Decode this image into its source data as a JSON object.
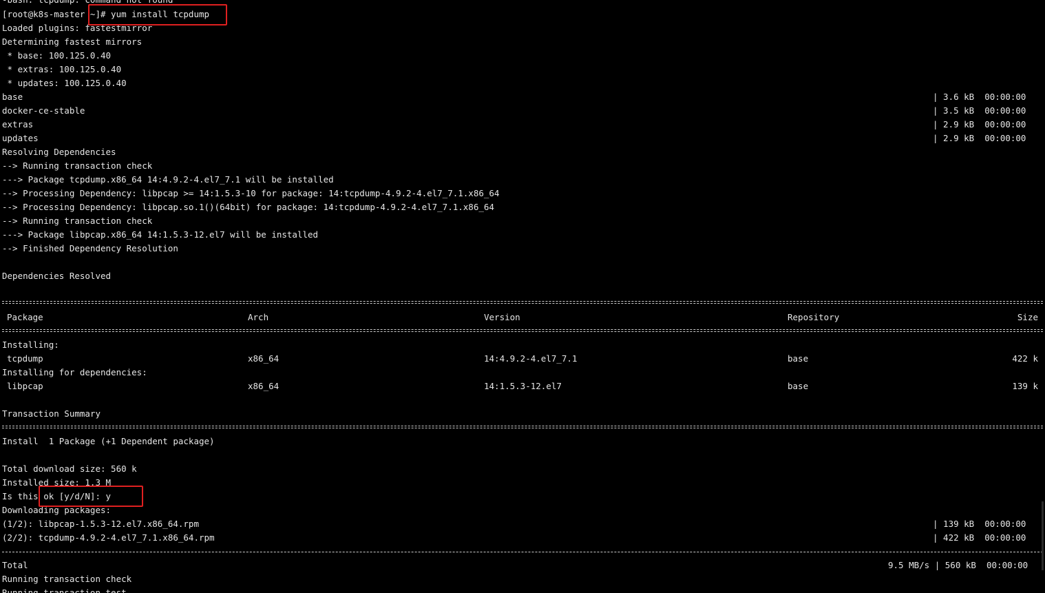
{
  "prev_output": "-bash: tcpdump: command not found",
  "prompt": "[root@k8s-master ~]",
  "command": "# yum install tcpdump",
  "plugins": "Loaded plugins: fastestmirror",
  "determining": "Determining fastest mirrors",
  "mirror_base": " * base: 100.125.0.40",
  "mirror_extras": " * extras: 100.125.0.40",
  "mirror_updates": " * updates: 100.125.0.40",
  "repos": [
    {
      "name": "base",
      "size": "| 3.6 kB  00:00:00"
    },
    {
      "name": "docker-ce-stable",
      "size": "| 3.5 kB  00:00:00"
    },
    {
      "name": "extras",
      "size": "| 2.9 kB  00:00:00"
    },
    {
      "name": "updates",
      "size": "| 2.9 kB  00:00:00"
    }
  ],
  "deps": [
    "Resolving Dependencies",
    "--> Running transaction check",
    "---> Package tcpdump.x86_64 14:4.9.2-4.el7_7.1 will be installed",
    "--> Processing Dependency: libpcap >= 14:1.5.3-10 for package: 14:tcpdump-4.9.2-4.el7_7.1.x86_64",
    "--> Processing Dependency: libpcap.so.1()(64bit) for package: 14:tcpdump-4.9.2-4.el7_7.1.x86_64",
    "--> Running transaction check",
    "---> Package libpcap.x86_64 14:1.5.3-12.el7 will be installed",
    "--> Finished Dependency Resolution"
  ],
  "deps_resolved": "Dependencies Resolved",
  "table": {
    "headers": {
      "package": "Package",
      "arch": "Arch",
      "version": "Version",
      "repository": "Repository",
      "size": "Size"
    },
    "installing_label": "Installing:",
    "installing": {
      "package": "tcpdump",
      "arch": "x86_64",
      "version": "14:4.9.2-4.el7_7.1",
      "repository": "base",
      "size": "422 k"
    },
    "deps_label": "Installing for dependencies:",
    "dependency": {
      "package": "libpcap",
      "arch": "x86_64",
      "version": "14:1.5.3-12.el7",
      "repository": "base",
      "size": "139 k"
    }
  },
  "summary_title": "Transaction Summary",
  "install_summary": "Install  1 Package (+1 Dependent package)",
  "total_download": "Total download size: 560 k",
  "installed_size": "Installed size: 1.3 M",
  "confirm_prompt": "Is this ok [y/d/N]: y",
  "downloading": "Downloading packages:",
  "downloads": [
    {
      "file": "(1/2): libpcap-1.5.3-12.el7.x86_64.rpm",
      "size": "| 139 kB  00:00:00"
    },
    {
      "file": "(2/2): tcpdump-4.9.2-4.el7_7.1.x86_64.rpm",
      "size": "| 422 kB  00:00:00"
    }
  ],
  "total_label": "Total",
  "total_value": "9.5 MB/s | 560 kB  00:00:00",
  "run_check": "Running transaction check",
  "run_test": "Running transaction test",
  "colors": {
    "background": "#000000",
    "text": "#e6e6e6",
    "highlight": "#e02020"
  }
}
